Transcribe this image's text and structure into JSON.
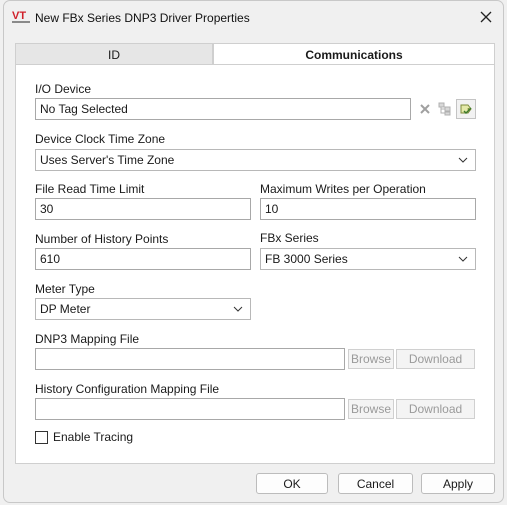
{
  "window": {
    "title": "New FBx Series DNP3 Driver Properties",
    "logo_text": "VT"
  },
  "tabs": [
    {
      "label": "ID",
      "active": false
    },
    {
      "label": "Communications",
      "active": true
    }
  ],
  "io_device": {
    "label": "I/O Device",
    "value": "No Tag Selected"
  },
  "clock_zone": {
    "label": "Device Clock Time Zone",
    "value": "Uses Server's Time Zone"
  },
  "file_read": {
    "label": "File Read Time Limit",
    "value": "30"
  },
  "max_writes": {
    "label": "Maximum Writes per Operation",
    "value": "10"
  },
  "history_points": {
    "label": "Number of History Points",
    "value": "610"
  },
  "fbx_series": {
    "label": "FBx Series",
    "value": "FB 3000 Series"
  },
  "meter_type": {
    "label": "Meter Type",
    "value": "DP Meter"
  },
  "dnp3_file": {
    "label": "DNP3 Mapping File",
    "value": "",
    "browse": "Browse",
    "download": "Download"
  },
  "history_file": {
    "label": "History Configuration Mapping File",
    "value": "",
    "browse": "Browse",
    "download": "Download"
  },
  "tracing": {
    "label": "Enable Tracing",
    "checked": false
  },
  "buttons": {
    "ok": "OK",
    "cancel": "Cancel",
    "apply": "Apply"
  },
  "colors": {
    "logo_red": "#d0202a",
    "panel": "#ffffff",
    "window": "#f0f0f0"
  }
}
